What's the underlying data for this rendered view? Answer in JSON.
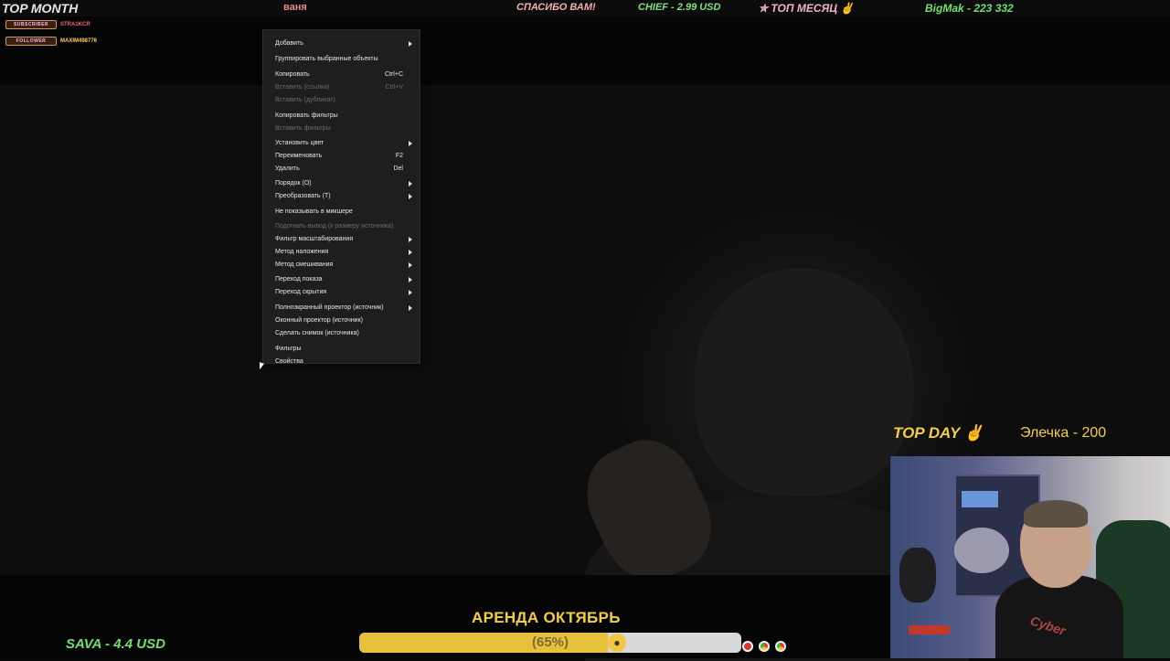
{
  "ticker": {
    "top_month": "TOP MONTH",
    "name": "ваня",
    "thanks": "СПАСИБО ВАМ!",
    "donation": "CHIEF - 2.99 USD",
    "top_month_ru": "✮ ТОП МЕСЯЦ ✌",
    "top_donor": "BigMak - 223 332"
  },
  "alerts": {
    "subscriber_badge": "SUBSCRIBER",
    "subscriber_name": "STRA1KCR",
    "follower_badge": "FOLLOWER",
    "follower_name": "MAXIM498776"
  },
  "context_menu": {
    "items": [
      {
        "label": "Добавить",
        "shortcut": "",
        "submenu": true,
        "disabled": false
      },
      {
        "label": "Группировать выбранные объекты",
        "shortcut": "",
        "submenu": false,
        "disabled": false
      },
      {
        "label": "Копировать",
        "shortcut": "Ctrl+C",
        "submenu": false,
        "disabled": false
      },
      {
        "label": "Вставить (ссылка)",
        "shortcut": "Ctrl+V",
        "submenu": false,
        "disabled": true
      },
      {
        "label": "Вставить (дубликат)",
        "shortcut": "",
        "submenu": false,
        "disabled": true
      },
      {
        "label": "Копировать фильтры",
        "shortcut": "",
        "submenu": false,
        "disabled": false
      },
      {
        "label": "Вставить фильтры",
        "shortcut": "",
        "submenu": false,
        "disabled": true
      },
      {
        "label": "Установить цвет",
        "shortcut": "",
        "submenu": true,
        "disabled": false
      },
      {
        "label": "Переименовать",
        "shortcut": "F2",
        "submenu": false,
        "disabled": false
      },
      {
        "label": "Удалить",
        "shortcut": "Del",
        "submenu": false,
        "disabled": false
      },
      {
        "label": "Порядок (O)",
        "shortcut": "",
        "submenu": true,
        "disabled": false
      },
      {
        "label": "Преобразовать (T)",
        "shortcut": "",
        "submenu": true,
        "disabled": false
      },
      {
        "label": "Не показывать в микшере",
        "shortcut": "",
        "submenu": false,
        "disabled": false
      },
      {
        "label": "Подогнать вывод (к размеру источника)",
        "shortcut": "",
        "submenu": false,
        "disabled": true
      },
      {
        "label": "Фильтр масштабирования",
        "shortcut": "",
        "submenu": true,
        "disabled": false
      },
      {
        "label": "Метод наложения",
        "shortcut": "",
        "submenu": true,
        "disabled": false
      },
      {
        "label": "Метод смешивания",
        "shortcut": "",
        "submenu": true,
        "disabled": false
      },
      {
        "label": "Переход показа",
        "shortcut": "",
        "submenu": true,
        "disabled": false
      },
      {
        "label": "Переход скрытия",
        "shortcut": "",
        "submenu": true,
        "disabled": false
      },
      {
        "label": "Полноэкранный проектор (источник)",
        "shortcut": "",
        "submenu": true,
        "disabled": false
      },
      {
        "label": "Оконный проектор (источник)",
        "shortcut": "",
        "submenu": false,
        "disabled": false
      },
      {
        "label": "Сделать снимок (источника)",
        "shortcut": "",
        "submenu": false,
        "disabled": false
      },
      {
        "label": "Фильтры",
        "shortcut": "",
        "submenu": false,
        "disabled": false
      },
      {
        "label": "Свойства",
        "shortcut": "",
        "submenu": false,
        "disabled": false
      }
    ]
  },
  "top_day": {
    "title": "TOP DAY ✌",
    "entry": "Элечка - 200"
  },
  "webcam": {
    "shirt_text": "Cyber"
  },
  "footer": {
    "goal_title": "АРЕНДА ОКТЯБРЬ",
    "goal_percent_text": "(65%)",
    "goal_progress": 0.65,
    "donor": "SAVA - 4.4 USD"
  },
  "colors": {
    "accent_yellow": "#f2cf3e",
    "accent_green": "#6fe06f"
  }
}
